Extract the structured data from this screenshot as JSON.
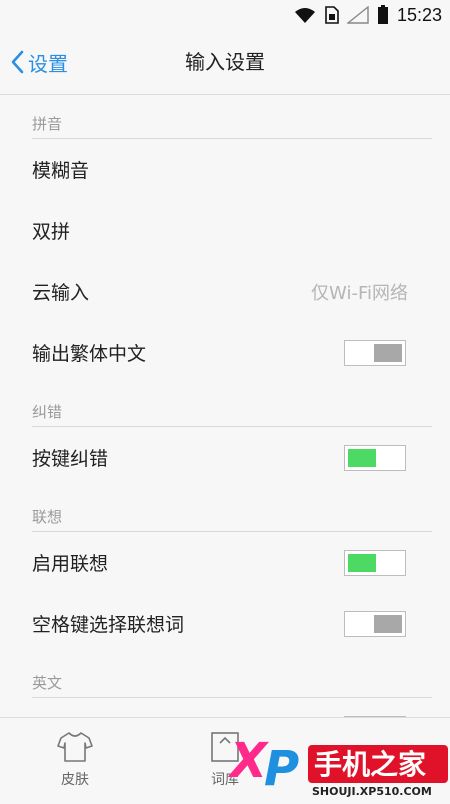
{
  "status_bar": {
    "time": "15:23"
  },
  "nav": {
    "back_label": "设置",
    "title": "输入设置"
  },
  "sections": {
    "pinyin": {
      "header": "拼音",
      "fuzzy": "模糊音",
      "double_pinyin": "双拼",
      "cloud_input": "云输入",
      "cloud_input_value": "仅Wi-Fi网络",
      "traditional": "输出繁体中文",
      "traditional_on": false
    },
    "correction": {
      "header": "纠错",
      "key_correction": "按键纠错",
      "key_correction_on": true
    },
    "association": {
      "header": "联想",
      "enable": "启用联想",
      "enable_on": true,
      "space_select": "空格键选择联想词",
      "space_select_on": false
    },
    "english": {
      "header": "英文"
    }
  },
  "tabs": {
    "skin": "皮肤",
    "word": "词库"
  },
  "watermark": {
    "logo_text": "XP手机之家",
    "url": "SHOUJI.XP510.COM"
  },
  "colors": {
    "accent": "#2a8fe3",
    "toggle_on": "#4cd964",
    "toggle_off": "#a8a8a8"
  }
}
